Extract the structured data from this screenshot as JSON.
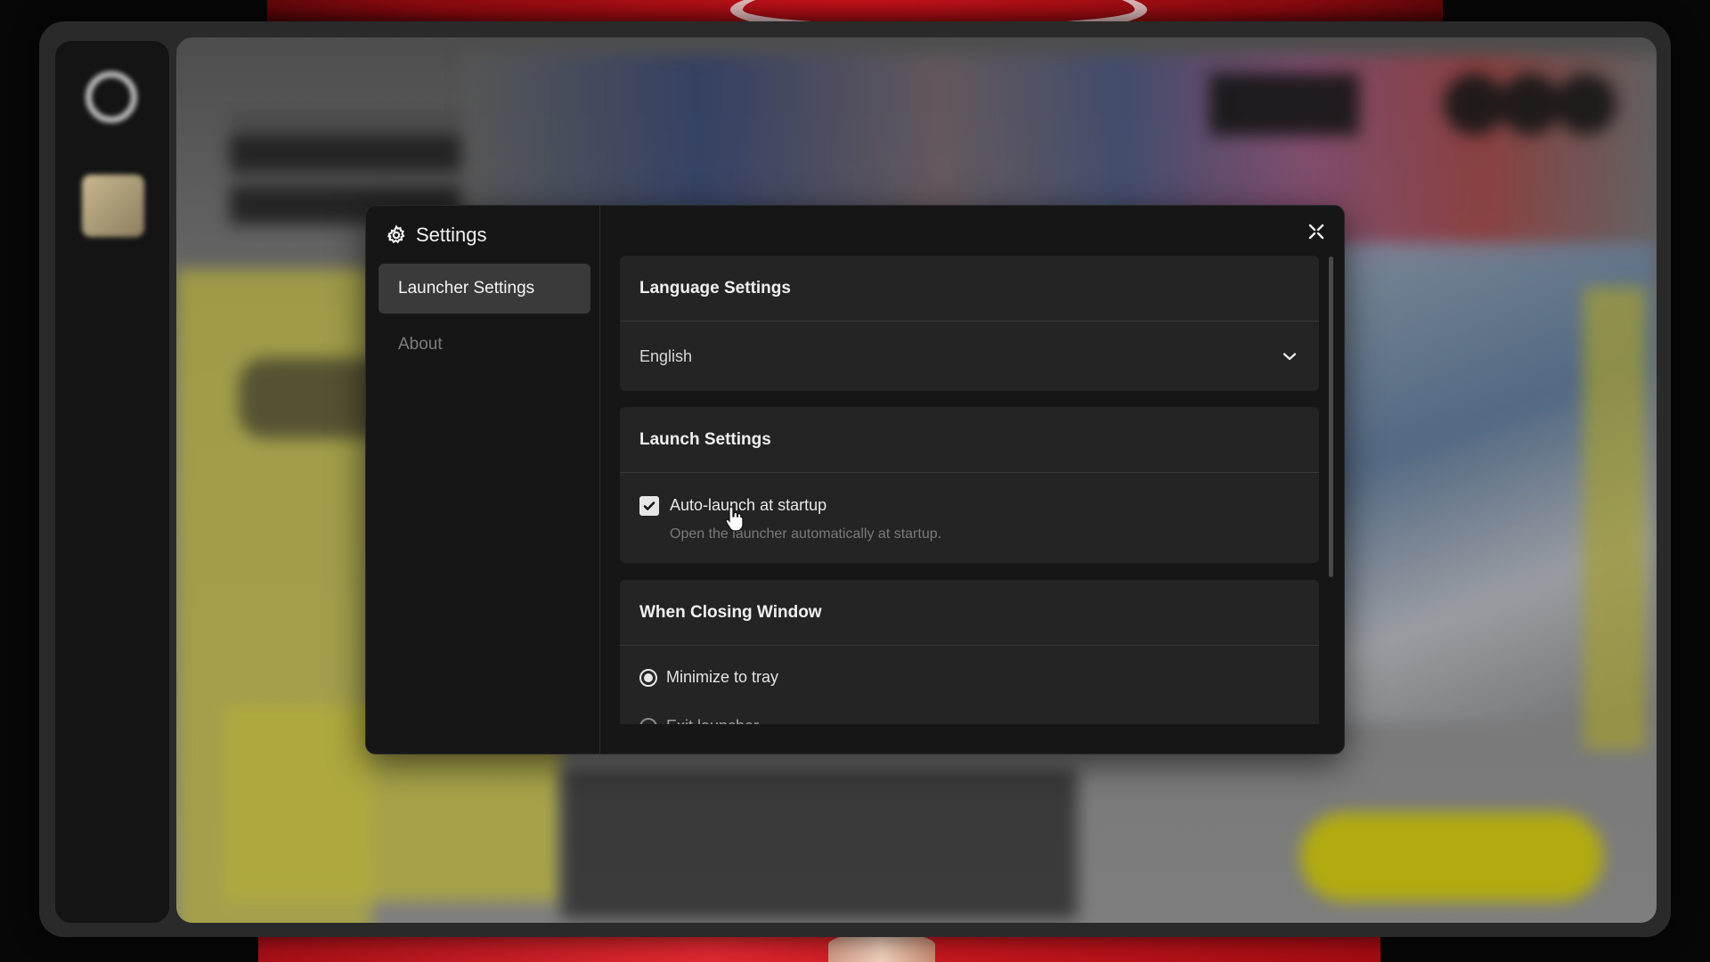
{
  "settings": {
    "title": "Settings",
    "nav": [
      {
        "label": "Launcher Settings",
        "active": true
      },
      {
        "label": "About",
        "active": false
      }
    ],
    "close_icon": "close-icon",
    "sections": {
      "language": {
        "title": "Language Settings",
        "selected": "English"
      },
      "launch": {
        "title": "Launch Settings",
        "auto_launch_label": "Auto-launch at startup",
        "auto_launch_desc": "Open the launcher automatically at startup.",
        "auto_launch_checked": true
      },
      "closing": {
        "title": "When Closing Window",
        "options": [
          {
            "label": "Minimize to tray",
            "selected": true
          },
          {
            "label": "Exit launcher",
            "selected": false
          }
        ]
      }
    }
  },
  "colors": {
    "dialog_bg": "#161616",
    "card_bg": "#242424",
    "nav_active_bg": "#3a3a3a",
    "accent_yellow": "#d9d113"
  }
}
